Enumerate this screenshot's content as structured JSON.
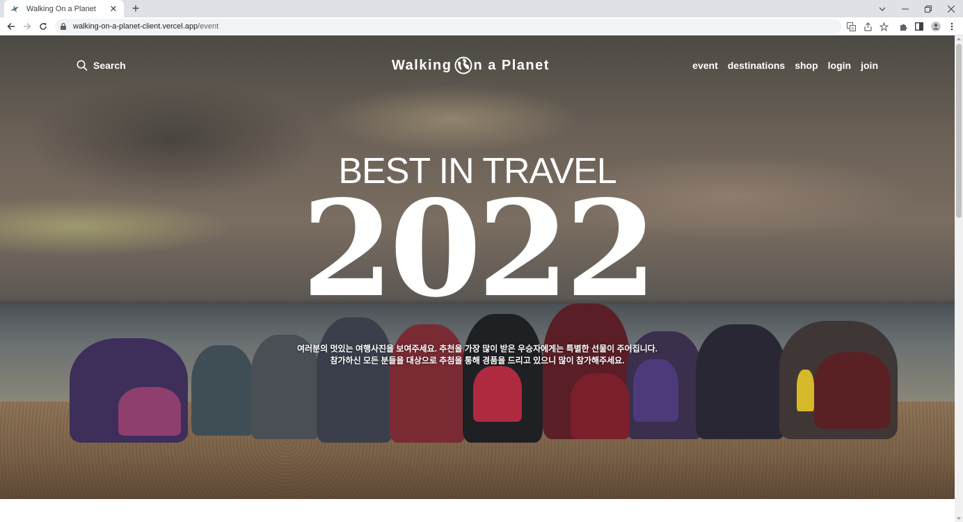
{
  "browser": {
    "tab_title": "Walking On a Planet",
    "url_host": "walking-on-a-planet-client.vercel.app",
    "url_path": "/event"
  },
  "site": {
    "search_label": "Search",
    "logo_prefix": "Walking ",
    "logo_suffix": "n a Planet",
    "nav": {
      "event": "event",
      "destinations": "destinations",
      "shop": "shop",
      "login": "login",
      "join": "join"
    }
  },
  "hero": {
    "headline": "BEST IN TRAVEL",
    "year": "2022",
    "caption_line1": "여러분의 멋있는 여행사진을 보여주세요. 추천을 가장 많이 받은 우승자에게는 특별한 선물이 주어집니다.",
    "caption_line2": "참가하신 모든 분들을 대상으로 추첨을 통해 경품을 드리고 있으니 많이 참가해주세요."
  },
  "colors": {
    "text_on_image": "#ffffff",
    "chrome_bg": "#dee1e6",
    "omnibox_bg": "#f1f3f4"
  },
  "icons": {
    "favicon": "bird-favicon-icon",
    "search": "magnifier-icon",
    "logo_globe": "globe-icon"
  }
}
